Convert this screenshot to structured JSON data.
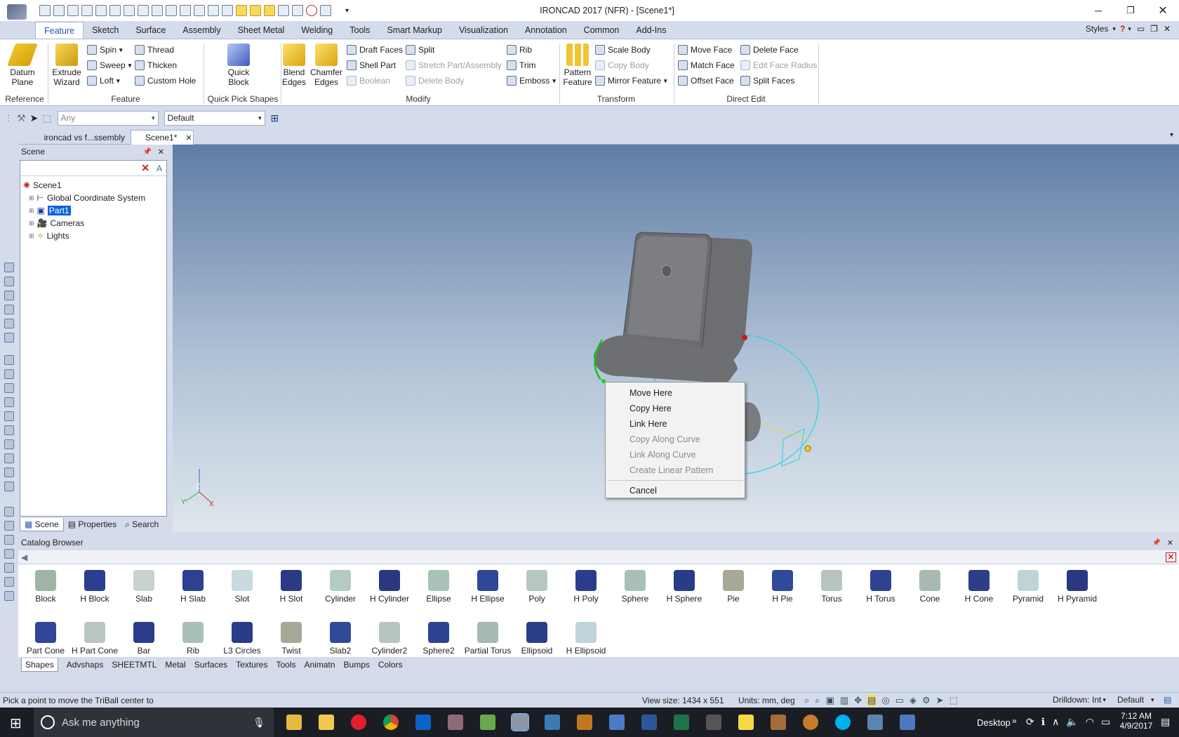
{
  "window": {
    "title": "IRONCAD 2017 (NFR) - [Scene1*]"
  },
  "ribbon_tabs": [
    "Feature",
    "Sketch",
    "Surface",
    "Assembly",
    "Sheet Metal",
    "Welding",
    "Tools",
    "Smart Markup",
    "Visualization",
    "Annotation",
    "Common",
    "Add-Ins"
  ],
  "styles_label": "Styles",
  "ribbon": {
    "datum_plane": "Datum Plane",
    "extrude_wizard": "Extrude Wizard",
    "spin": "Spin",
    "sweep": "Sweep",
    "loft": "Loft",
    "thread": "Thread",
    "thicken": "Thicken",
    "custom_hole": "Custom Hole",
    "quick_block": "Quick Block",
    "blend_edges": "Blend Edges",
    "chamfer_edges": "Chamfer Edges",
    "draft_faces": "Draft Faces",
    "shell_part": "Shell Part",
    "boolean": "Boolean",
    "split": "Split",
    "stretch": "Stretch Part/Assembly",
    "delete_body": "Delete Body",
    "rib": "Rib",
    "trim": "Trim",
    "emboss": "Emboss",
    "pattern_feature": "Pattern Feature",
    "scale_body": "Scale Body",
    "copy_body": "Copy Body",
    "mirror_feature": "Mirror Feature",
    "move_face": "Move Face",
    "match_face": "Match Face",
    "offset_face": "Offset Face",
    "delete_face": "Delete Face",
    "edit_face_radius": "Edit Face Radius",
    "split_faces": "Split Faces",
    "groups": {
      "reference": "Reference",
      "feature": "Feature",
      "quick_pick": "Quick Pick Shapes",
      "modify": "Modify",
      "transform": "Transform",
      "direct_edit": "Direct Edit"
    }
  },
  "filter": {
    "selection": "Any",
    "style": "Default"
  },
  "doc_tabs": [
    "ironcad vs f...ssembly",
    "Scene1*"
  ],
  "scene_panel": {
    "title": "Scene",
    "tree": [
      "Scene1",
      "Global Coordinate System",
      "Part1",
      "Cameras",
      "Lights"
    ],
    "bottom_tabs": [
      "Scene",
      "Properties",
      "Search"
    ]
  },
  "axis_labels": {
    "z": "Z",
    "x": "X",
    "y": "Y"
  },
  "context_menu": [
    {
      "label": "Move Here",
      "enabled": true
    },
    {
      "label": "Copy Here",
      "enabled": true
    },
    {
      "label": "Link Here",
      "enabled": true
    },
    {
      "label": "Copy Along Curve",
      "enabled": false
    },
    {
      "label": "Link Along Curve",
      "enabled": false
    },
    {
      "label": "Create Linear Pattern",
      "enabled": false
    },
    {
      "label": "Cancel",
      "enabled": true
    }
  ],
  "catalog": {
    "title": "Catalog Browser",
    "row1": [
      "Block",
      "H Block",
      "Slab",
      "H Slab",
      "Slot",
      "H Slot",
      "Cylinder",
      "H Cylinder",
      "Ellipse",
      "H Ellipse",
      "Poly",
      "H Poly",
      "Sphere",
      "H Sphere",
      "Pie",
      "H Pie",
      "Torus",
      "H Torus",
      "Cone",
      "H Cone",
      "Pyramid",
      "H Pyramid"
    ],
    "row2": [
      "Part Cone",
      "H Part Cone",
      "Bar",
      "Rib",
      "L3 Circles",
      "Twist",
      "Slab2",
      "Cylinder2",
      "Sphere2",
      "Partial Torus",
      "Ellipsoid",
      "H Ellipsoid"
    ],
    "tabs": [
      "Shapes",
      "Advshaps",
      "SHEETMTL",
      "Metal",
      "Surfaces",
      "Textures",
      "Tools",
      "Animatn",
      "Bumps",
      "Colors"
    ]
  },
  "status": {
    "message": "Pick a point to move the TriBall center to",
    "view_size": "View size: 1434 x  551",
    "units": "Units: mm, deg",
    "drilldown": "Drilldown: Int",
    "mode": "Default"
  },
  "taskbar": {
    "search_placeholder": "Ask me anything",
    "desktop": "Desktop",
    "time": "7:12 AM",
    "date": "4/9/2017"
  }
}
